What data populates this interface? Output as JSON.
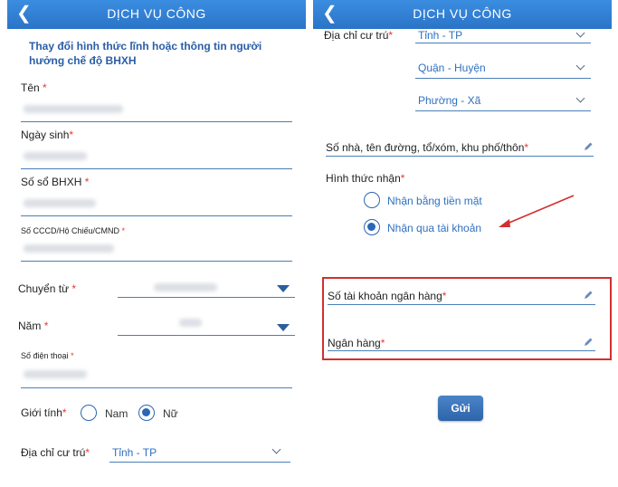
{
  "header": {
    "title": "DỊCH VỤ CÔNG",
    "back_icon": "chevron-left-icon"
  },
  "left_form": {
    "intro_line1": "Thay đổi hình thức lĩnh hoặc thông tin người",
    "intro_line2": "hưởng chế độ BHXH",
    "name_label": "Tên",
    "dob_label": "Ngày sinh",
    "bhxh_label": "Số sổ BHXH",
    "id_label": "Số CCCD/Hộ Chiếu/CMND",
    "transfer_label": "Chuyển từ",
    "year_label": "Năm",
    "phone_label": "Số điện thoại",
    "gender_label": "Giới tính",
    "gender_male": "Nam",
    "gender_female": "Nữ",
    "gender_selected": "Nữ",
    "address_label": "Địa chỉ cư trú",
    "province_value": "Tỉnh - TP",
    "required_mark": "*"
  },
  "right_form": {
    "address_label": "Địa chỉ cư trú",
    "province_value": "Tỉnh - TP",
    "district_value": "Quận - Huyện",
    "ward_value": "Phường - Xã",
    "street_label": "Số nhà, tên đường, tổ/xóm, khu phố/thôn",
    "receive_method_label": "Hình thức nhận",
    "cash_option": "Nhận bằng tiền mặt",
    "account_option": "Nhận qua tài khoản",
    "selected_option": "Nhận qua tài khoản",
    "bank_account_label": "Số tài khoản ngân hàng",
    "bank_label": "Ngân hàng",
    "submit_label": "Gửi",
    "required_mark": "*"
  },
  "colors": {
    "header": "#2b74c8",
    "accent": "#2b67b4",
    "required": "#e53935",
    "highlight": "#d32f2f"
  }
}
